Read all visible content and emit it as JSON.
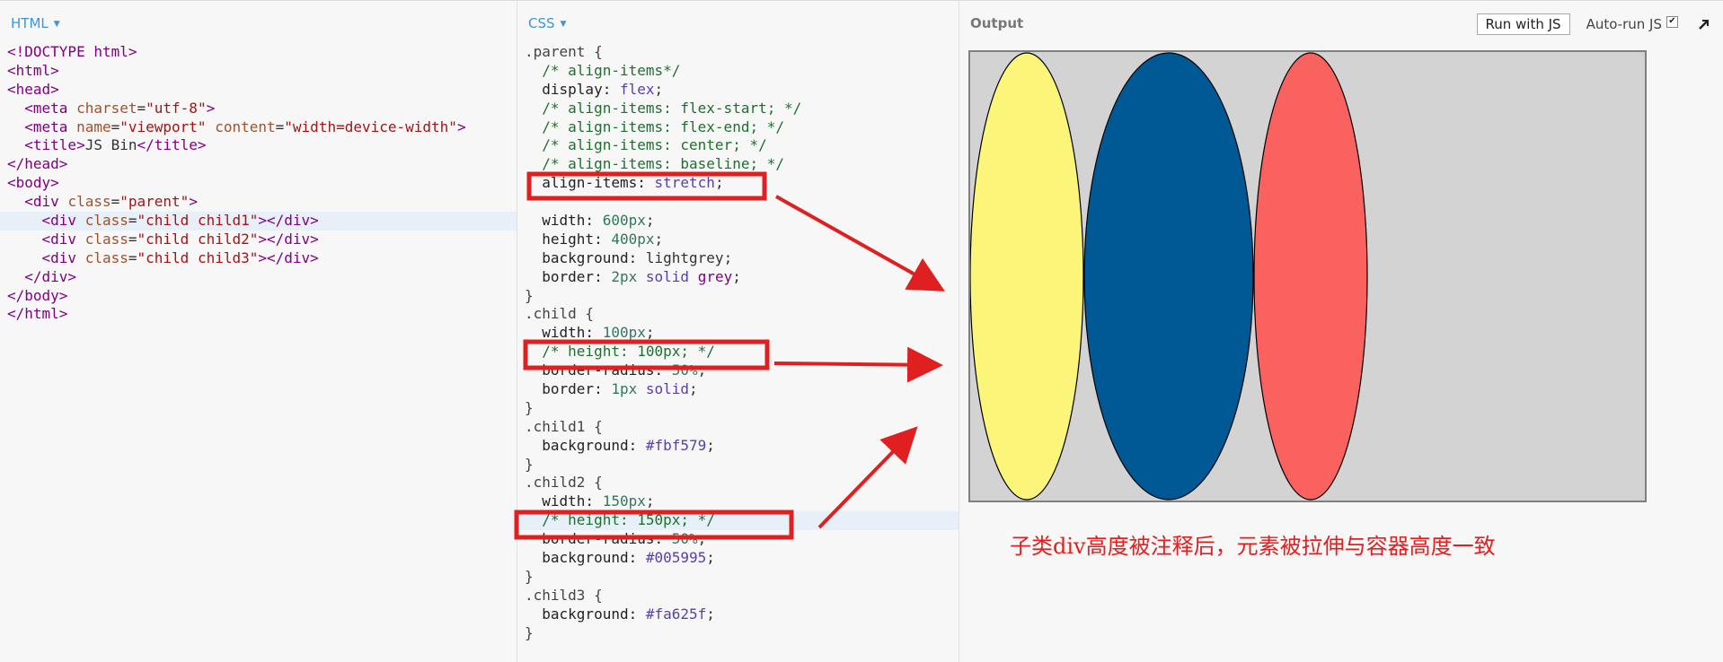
{
  "html_pane": {
    "title": "HTML",
    "lines": [
      [
        {
          "c": "t-tag",
          "t": "<!DOCTYPE html>"
        }
      ],
      [
        {
          "c": "t-tag",
          "t": "<html>"
        }
      ],
      [
        {
          "c": "t-tag",
          "t": "<head>"
        }
      ],
      [
        {
          "t": "  "
        },
        {
          "c": "t-tag",
          "t": "<meta "
        },
        {
          "c": "t-attr",
          "t": "charset"
        },
        {
          "t": "="
        },
        {
          "c": "t-val",
          "t": "\"utf-8\""
        },
        {
          "c": "t-tag",
          "t": ">"
        }
      ],
      [
        {
          "t": "  "
        },
        {
          "c": "t-tag",
          "t": "<meta "
        },
        {
          "c": "t-attr",
          "t": "name"
        },
        {
          "t": "="
        },
        {
          "c": "t-val",
          "t": "\"viewport\""
        },
        {
          "t": " "
        },
        {
          "c": "t-attr",
          "t": "content"
        },
        {
          "t": "="
        },
        {
          "c": "t-val",
          "t": "\"width=device-width\""
        },
        {
          "c": "t-tag",
          "t": ">"
        }
      ],
      [
        {
          "t": "  "
        },
        {
          "c": "t-tag",
          "t": "<title>"
        },
        {
          "t": "JS Bin"
        },
        {
          "c": "t-tag",
          "t": "</title>"
        }
      ],
      [
        {
          "c": "t-tag",
          "t": "</head>"
        }
      ],
      [
        {
          "c": "t-tag",
          "t": "<body>"
        }
      ],
      [
        {
          "t": "  "
        },
        {
          "c": "t-tag",
          "t": "<div "
        },
        {
          "c": "t-attr",
          "t": "class"
        },
        {
          "t": "="
        },
        {
          "c": "t-val",
          "t": "\"parent\""
        },
        {
          "c": "t-tag",
          "t": ">"
        }
      ],
      [
        {
          "t": "    "
        },
        {
          "c": "t-tag",
          "t": "<div "
        },
        {
          "c": "t-attr",
          "t": "class"
        },
        {
          "t": "="
        },
        {
          "c": "t-val",
          "t": "\"child child1\""
        },
        {
          "c": "t-tag",
          "t": "></div>"
        }
      ],
      [
        {
          "t": "    "
        },
        {
          "c": "t-tag",
          "t": "<div "
        },
        {
          "c": "t-attr",
          "t": "class"
        },
        {
          "t": "="
        },
        {
          "c": "t-val",
          "t": "\"child child2\""
        },
        {
          "c": "t-tag",
          "t": "></div>"
        }
      ],
      [
        {
          "t": "    "
        },
        {
          "c": "t-tag",
          "t": "<div "
        },
        {
          "c": "t-attr",
          "t": "class"
        },
        {
          "t": "="
        },
        {
          "c": "t-val",
          "t": "\"child child3\""
        },
        {
          "c": "t-tag",
          "t": "></div>"
        }
      ],
      [
        {
          "t": "  "
        },
        {
          "c": "t-tag",
          "t": "</div>"
        }
      ],
      [
        {
          "c": "t-tag",
          "t": "</body>"
        }
      ],
      [
        {
          "c": "t-tag",
          "t": "</html>"
        }
      ]
    ],
    "highlight_line": 9
  },
  "css_pane": {
    "title": "CSS",
    "lines": [
      [
        {
          "c": "t-sel",
          "t": ".parent {"
        }
      ],
      [
        {
          "t": "  "
        },
        {
          "c": "t-cm",
          "t": "/* align-items*/"
        }
      ],
      [
        {
          "t": "  "
        },
        {
          "c": "t-prop",
          "t": "display: "
        },
        {
          "c": "t-kw",
          "t": "flex"
        },
        {
          "t": ";"
        }
      ],
      [
        {
          "t": "  "
        },
        {
          "c": "t-cm",
          "t": "/* align-items: flex-start; */"
        }
      ],
      [
        {
          "t": "  "
        },
        {
          "c": "t-cm",
          "t": "/* align-items: flex-end; */"
        }
      ],
      [
        {
          "t": "  "
        },
        {
          "c": "t-cm",
          "t": "/* align-items: center; */"
        }
      ],
      [
        {
          "t": "  "
        },
        {
          "c": "t-cm",
          "t": "/* align-items: baseline; */"
        }
      ],
      [
        {
          "t": "  "
        },
        {
          "c": "t-prop",
          "t": "align-items: "
        },
        {
          "c": "t-kw",
          "t": "stretch"
        },
        {
          "t": ";"
        }
      ],
      [
        {
          "t": ""
        }
      ],
      [
        {
          "t": "  "
        },
        {
          "c": "t-prop",
          "t": "width: "
        },
        {
          "c": "t-num",
          "t": "600px"
        },
        {
          "t": ";"
        }
      ],
      [
        {
          "t": "  "
        },
        {
          "c": "t-prop",
          "t": "height: "
        },
        {
          "c": "t-num",
          "t": "400px"
        },
        {
          "t": ";"
        }
      ],
      [
        {
          "t": "  "
        },
        {
          "c": "t-prop",
          "t": "background: "
        },
        {
          "t": "lightgrey"
        },
        {
          "t": ";"
        }
      ],
      [
        {
          "t": "  "
        },
        {
          "c": "t-prop",
          "t": "border: "
        },
        {
          "c": "t-num",
          "t": "2px"
        },
        {
          "t": " "
        },
        {
          "c": "t-kw",
          "t": "solid"
        },
        {
          "t": " "
        },
        {
          "c": "t-tag",
          "t": "grey"
        },
        {
          "t": ";"
        }
      ],
      [
        {
          "c": "t-sel",
          "t": "}"
        }
      ],
      [
        {
          "c": "t-sel",
          "t": ".child {"
        }
      ],
      [
        {
          "t": "  "
        },
        {
          "c": "t-prop",
          "t": "width: "
        },
        {
          "c": "t-num",
          "t": "100px"
        },
        {
          "t": ";"
        }
      ],
      [
        {
          "t": "  "
        },
        {
          "c": "t-cm",
          "t": "/* height: 100px; */"
        }
      ],
      [
        {
          "t": "  "
        },
        {
          "c": "t-prop",
          "t": "border-radius: "
        },
        {
          "c": "t-num",
          "t": "50%"
        },
        {
          "t": ";"
        }
      ],
      [
        {
          "t": "  "
        },
        {
          "c": "t-prop",
          "t": "border: "
        },
        {
          "c": "t-num",
          "t": "1px"
        },
        {
          "t": " "
        },
        {
          "c": "t-kw",
          "t": "solid"
        },
        {
          "t": ";"
        }
      ],
      [
        {
          "c": "t-sel",
          "t": "}"
        }
      ],
      [
        {
          "c": "t-sel",
          "t": ".child1 {"
        }
      ],
      [
        {
          "t": "  "
        },
        {
          "c": "t-prop",
          "t": "background: "
        },
        {
          "c": "t-kw",
          "t": "#fbf579"
        },
        {
          "t": ";"
        }
      ],
      [
        {
          "c": "t-sel",
          "t": "}"
        }
      ],
      [
        {
          "c": "t-sel",
          "t": ".child2 {"
        }
      ],
      [
        {
          "t": "  "
        },
        {
          "c": "t-prop",
          "t": "width: "
        },
        {
          "c": "t-num",
          "t": "150px"
        },
        {
          "t": ";"
        }
      ],
      [
        {
          "t": "  "
        },
        {
          "c": "t-cm",
          "t": "/* height: 150px; */"
        }
      ],
      [
        {
          "t": "  "
        },
        {
          "c": "t-prop",
          "t": "border-radius: "
        },
        {
          "c": "t-num",
          "t": "50%"
        },
        {
          "t": ";"
        }
      ],
      [
        {
          "t": "  "
        },
        {
          "c": "t-prop",
          "t": "background: "
        },
        {
          "c": "t-kw",
          "t": "#005995"
        },
        {
          "t": ";"
        }
      ],
      [
        {
          "c": "t-sel",
          "t": "}"
        }
      ],
      [
        {
          "c": "t-sel",
          "t": ".child3 {"
        }
      ],
      [
        {
          "t": "  "
        },
        {
          "c": "t-prop",
          "t": "background: "
        },
        {
          "c": "t-kw",
          "t": "#fa625f"
        },
        {
          "t": ";"
        }
      ],
      [
        {
          "c": "t-sel",
          "t": "}"
        }
      ]
    ],
    "highlight_line": 25
  },
  "output_pane": {
    "title": "Output",
    "run_button": "Run with JS",
    "autorun_label": "Auto-run JS",
    "autorun_checked": true,
    "autorun_check_glyph": "✔",
    "popout_icon": "popout-arrow-icon"
  },
  "preview": {
    "background": "#d3d3d3",
    "border_color": "#808080",
    "children": [
      {
        "name": "child1",
        "color": "#fbf579"
      },
      {
        "name": "child2",
        "color": "#005995"
      },
      {
        "name": "child3",
        "color": "#fa625f"
      }
    ]
  },
  "annotation": {
    "note": "子类div高度被注释后，元素被拉伸与容器高度一致",
    "color": "#e02020"
  },
  "colors": {
    "accent": "#3a96d6",
    "highlight": "#e7eff9",
    "annotation_red": "#e02020"
  }
}
